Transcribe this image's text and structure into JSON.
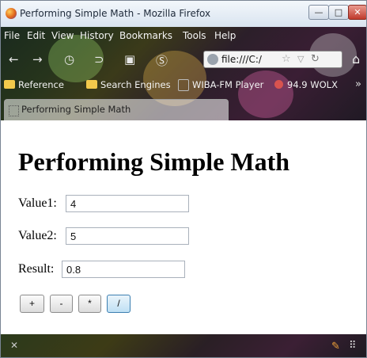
{
  "window": {
    "title": "Performing Simple Math - Mozilla Firefox",
    "controls": {
      "minimize": "—",
      "maximize": "□",
      "close": "✕"
    }
  },
  "menu": [
    "File",
    "Edit",
    "View",
    "History",
    "Bookmarks",
    "Tools",
    "Help"
  ],
  "navigation": {
    "back_icon": "back-arrow-icon",
    "forward_icon": "forward-arrow-icon",
    "url": "file:///C:/",
    "home_icon": "home-icon"
  },
  "bookmarks": [
    "Reference",
    "Search Engines",
    "WIBA-FM Player",
    "94.9 WOLX"
  ],
  "tab": {
    "label": "Performing Simple Math"
  },
  "page": {
    "heading": "Performing Simple Math",
    "value1_label": "Value1:",
    "value1": "4",
    "value2_label": "Value2:",
    "value2": "5",
    "result_label": "Result:",
    "result": "0.8",
    "buttons": [
      "+",
      "-",
      "*",
      "/"
    ]
  },
  "colors": {
    "accent_button_border": "#3c7fb1"
  }
}
